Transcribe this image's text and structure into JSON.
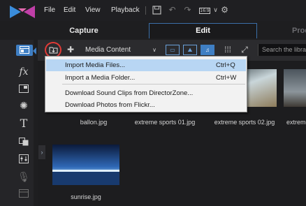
{
  "menubar": {
    "items": [
      "File",
      "Edit",
      "View",
      "Playback"
    ],
    "aspect_ratio": "16:9",
    "icons": [
      "save-icon",
      "undo-icon",
      "redo-icon",
      "settings-icon"
    ]
  },
  "modes": {
    "capture": "Capture",
    "edit": "Edit",
    "produce": "Produce",
    "active": "Edit"
  },
  "sidebar": {
    "icons": [
      "media-room-icon",
      "fx-icon",
      "pip-icon",
      "particle-icon",
      "title-icon",
      "transition-icon",
      "audio-mixing-icon",
      "voice-over-icon",
      "chapter-icon"
    ],
    "fx_glyph": "fx",
    "title_glyph": "T"
  },
  "toolbar": {
    "media_filter": "Media Content",
    "search_placeholder": "Search the library"
  },
  "import_menu": {
    "items": [
      {
        "label": "Import Media Files...",
        "shortcut": "Ctrl+Q",
        "highlighted": true
      },
      {
        "label": "Import a Media Folder...",
        "shortcut": "Ctrl+W",
        "highlighted": false
      },
      {
        "label": "Download Sound Clips from DirectorZone...",
        "shortcut": "",
        "highlighted": false
      },
      {
        "label": "Download Photos from Flickr...",
        "shortcut": "",
        "highlighted": false
      }
    ]
  },
  "library": {
    "items": [
      {
        "name": "ballon.jpg"
      },
      {
        "name": "extreme sports 01.jpg"
      },
      {
        "name": "extreme sports 02.jpg"
      },
      {
        "name": "extreme"
      },
      {
        "name": "sunrise.jpg"
      }
    ]
  },
  "colors": {
    "accent": "#3f7fc4",
    "highlight": "#b8d6f3",
    "annotation_ring": "#e23a36"
  }
}
